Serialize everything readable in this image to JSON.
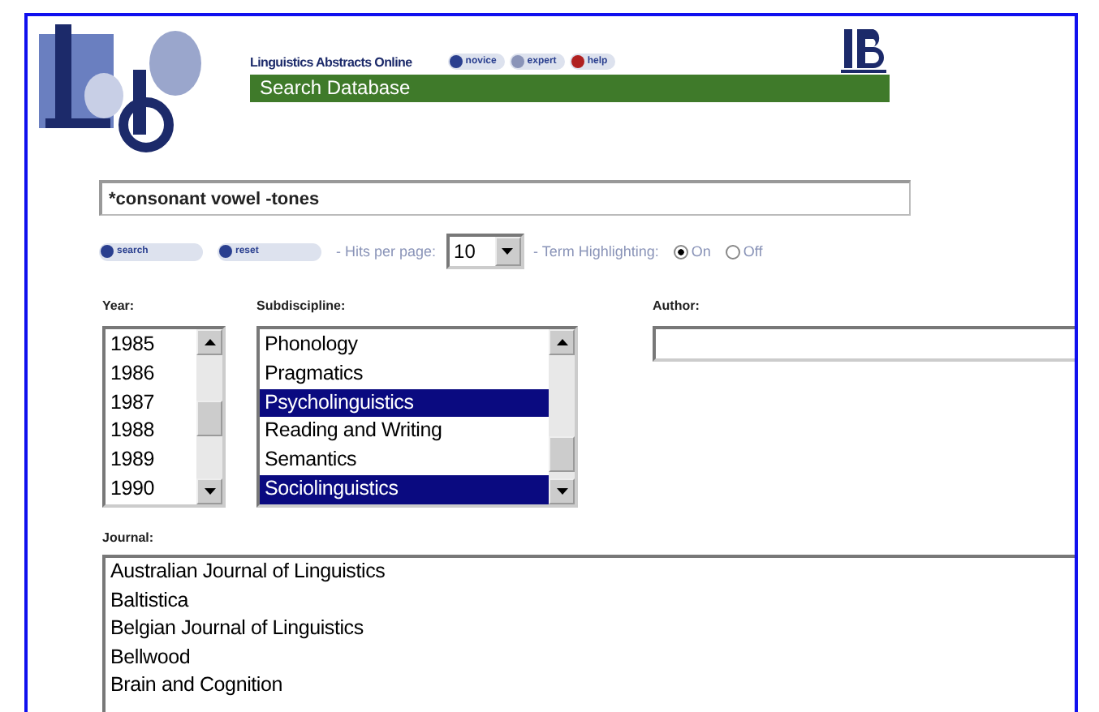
{
  "header": {
    "site_title": "Linguistics Abstracts Online",
    "mode_buttons": [
      {
        "label": "novice",
        "kind": "novice"
      },
      {
        "label": "expert",
        "kind": "expert"
      },
      {
        "label": "help",
        "kind": "help"
      }
    ],
    "page_title": "Search Database"
  },
  "query": {
    "value": "*consonant vowel -tones"
  },
  "actions": [
    {
      "label": "search"
    },
    {
      "label": "reset"
    }
  ],
  "hits_label": "- Hits per page:",
  "hits_value": "10",
  "highlight_label": "- Term Highlighting:",
  "highlight_options": [
    {
      "label": "On",
      "selected": true
    },
    {
      "label": "Off",
      "selected": false
    }
  ],
  "year": {
    "label": "Year:",
    "items": [
      {
        "label": "1985",
        "selected": false
      },
      {
        "label": "1986",
        "selected": false
      },
      {
        "label": "1987",
        "selected": false
      },
      {
        "label": "1988",
        "selected": false
      },
      {
        "label": "1989",
        "selected": false
      },
      {
        "label": "1990",
        "selected": false
      }
    ]
  },
  "subdiscipline": {
    "label": "Subdiscipline:",
    "items": [
      {
        "label": "Phonology",
        "selected": false
      },
      {
        "label": "Pragmatics",
        "selected": false
      },
      {
        "label": "Psycholinguistics",
        "selected": true
      },
      {
        "label": "Reading and Writing",
        "selected": false
      },
      {
        "label": "Semantics",
        "selected": false
      },
      {
        "label": "Sociolinguistics",
        "selected": true
      }
    ]
  },
  "author": {
    "label": "Author:"
  },
  "journal": {
    "label": "Journal:",
    "items": [
      {
        "label": "Australian Journal of Linguistics",
        "selected": false
      },
      {
        "label": "Baltistica",
        "selected": false
      },
      {
        "label": "Belgian Journal of Linguistics",
        "selected": false
      },
      {
        "label": "Bellwood",
        "selected": false
      },
      {
        "label": "Brain and Cognition",
        "selected": false
      }
    ]
  }
}
